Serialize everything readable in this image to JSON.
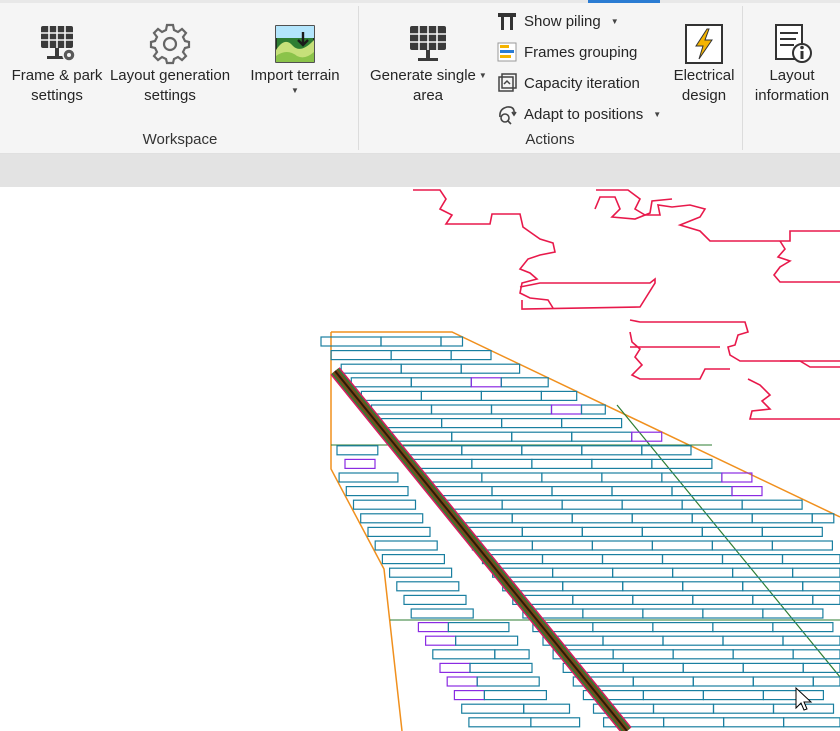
{
  "ribbon": {
    "workspace": {
      "group_label": "Workspace",
      "frame_park_settings": {
        "line1": "Frame & park",
        "line2": "settings",
        "icon": "solar-panel-gear-icon"
      },
      "layout_generation_settings": {
        "line1": "Layout generation",
        "line2": "settings",
        "icon": "gear-icon"
      },
      "import_terrain": {
        "line1": "Import terrain",
        "icon": "terrain-import-icon"
      }
    },
    "actions": {
      "group_label": "Actions",
      "generate_single_area": {
        "line1": "Generate single",
        "line2": "area",
        "icon": "solar-panel-icon"
      },
      "show_piling": {
        "label": "Show piling",
        "icon": "piling-icon"
      },
      "frames_grouping": {
        "label": "Frames grouping",
        "icon": "frames-grouping-icon"
      },
      "capacity_iteration": {
        "label": "Capacity iteration",
        "icon": "capacity-iteration-icon"
      },
      "adapt_to_positions": {
        "label": "Adapt to positions",
        "icon": "adapt-positions-icon"
      },
      "electrical_design": {
        "line1": "Electrical",
        "line2": "design",
        "icon": "lightning-icon"
      },
      "layout_information": {
        "line1": "Layout",
        "line2": "information",
        "icon": "info-document-icon"
      }
    }
  },
  "canvas": {
    "colors": {
      "boundary": "#f0901e",
      "frame": "#1a7fa0",
      "frame_highlight": "#8a2be2",
      "terrain_contour": "#e8194b",
      "road": "#7a4a1a",
      "road_edge": "#d81b60",
      "divider": "#2e7d32"
    }
  }
}
